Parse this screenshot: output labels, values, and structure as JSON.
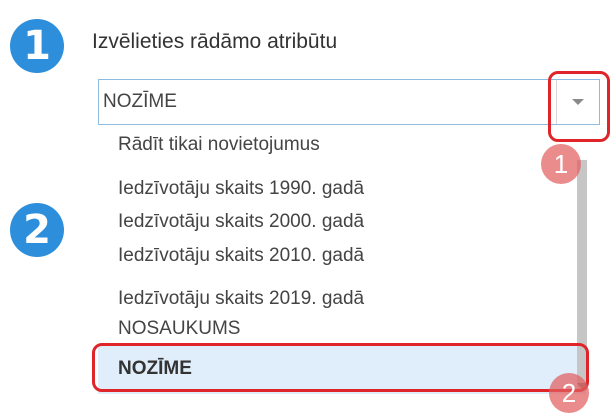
{
  "steps": [
    {
      "number": "1",
      "title": "Izvēlieties rādāmo atribūtu"
    },
    {
      "number": "2"
    }
  ],
  "select": {
    "value": "NOZĪME"
  },
  "options": [
    "Rādīt tikai novietojumus",
    "Iedzīvotāju skaits 1990. gadā",
    "Iedzīvotāju skaits 2000. gadā",
    "Iedzīvotāju skaits 2010. gadā",
    "Iedzīvotāju skaits 2019. gadā",
    "NOSAUKUMS",
    "NOZĪME"
  ],
  "selected_option": "NOZĪME",
  "annotations": {
    "marker_1": "1",
    "marker_2": "2",
    "highlight_color": "#e0252a"
  },
  "colors": {
    "step_badge": "#2d8fdc",
    "selected_row": "#dfeefa"
  }
}
